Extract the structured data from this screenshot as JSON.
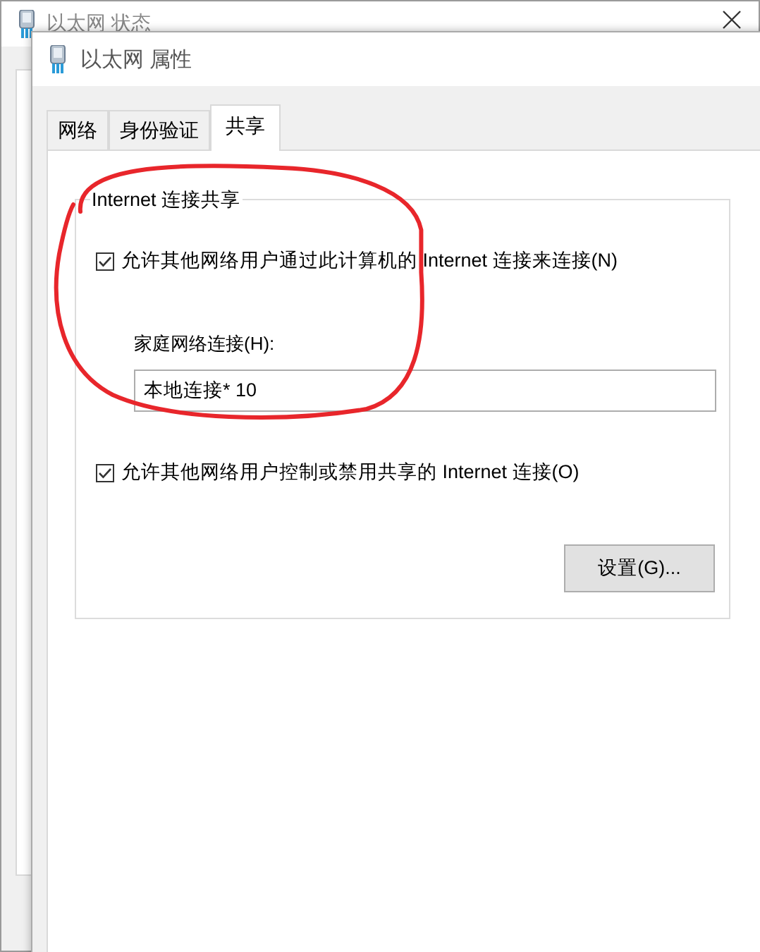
{
  "background_window": {
    "title": "以太网 状态"
  },
  "window": {
    "title": "以太网 属性"
  },
  "tabs": [
    {
      "label": "网络",
      "selected": false
    },
    {
      "label": "身份验证",
      "selected": false
    },
    {
      "label": "共享",
      "selected": true
    }
  ],
  "group": {
    "title": "Internet 连接共享"
  },
  "options": [
    {
      "kind": "checkbox",
      "label": "允许其他网络用户通过此计算机的 Internet 连接来连接(N)",
      "checked": true
    },
    {
      "kind": "field",
      "label": "家庭网络连接(H):",
      "value": "本地连接* 10"
    },
    {
      "kind": "checkbox",
      "label": "允许其他网络用户控制或禁用共享的 Internet 连接(O)",
      "checked": true
    }
  ],
  "buttons": [
    "设置(G)..."
  ]
}
